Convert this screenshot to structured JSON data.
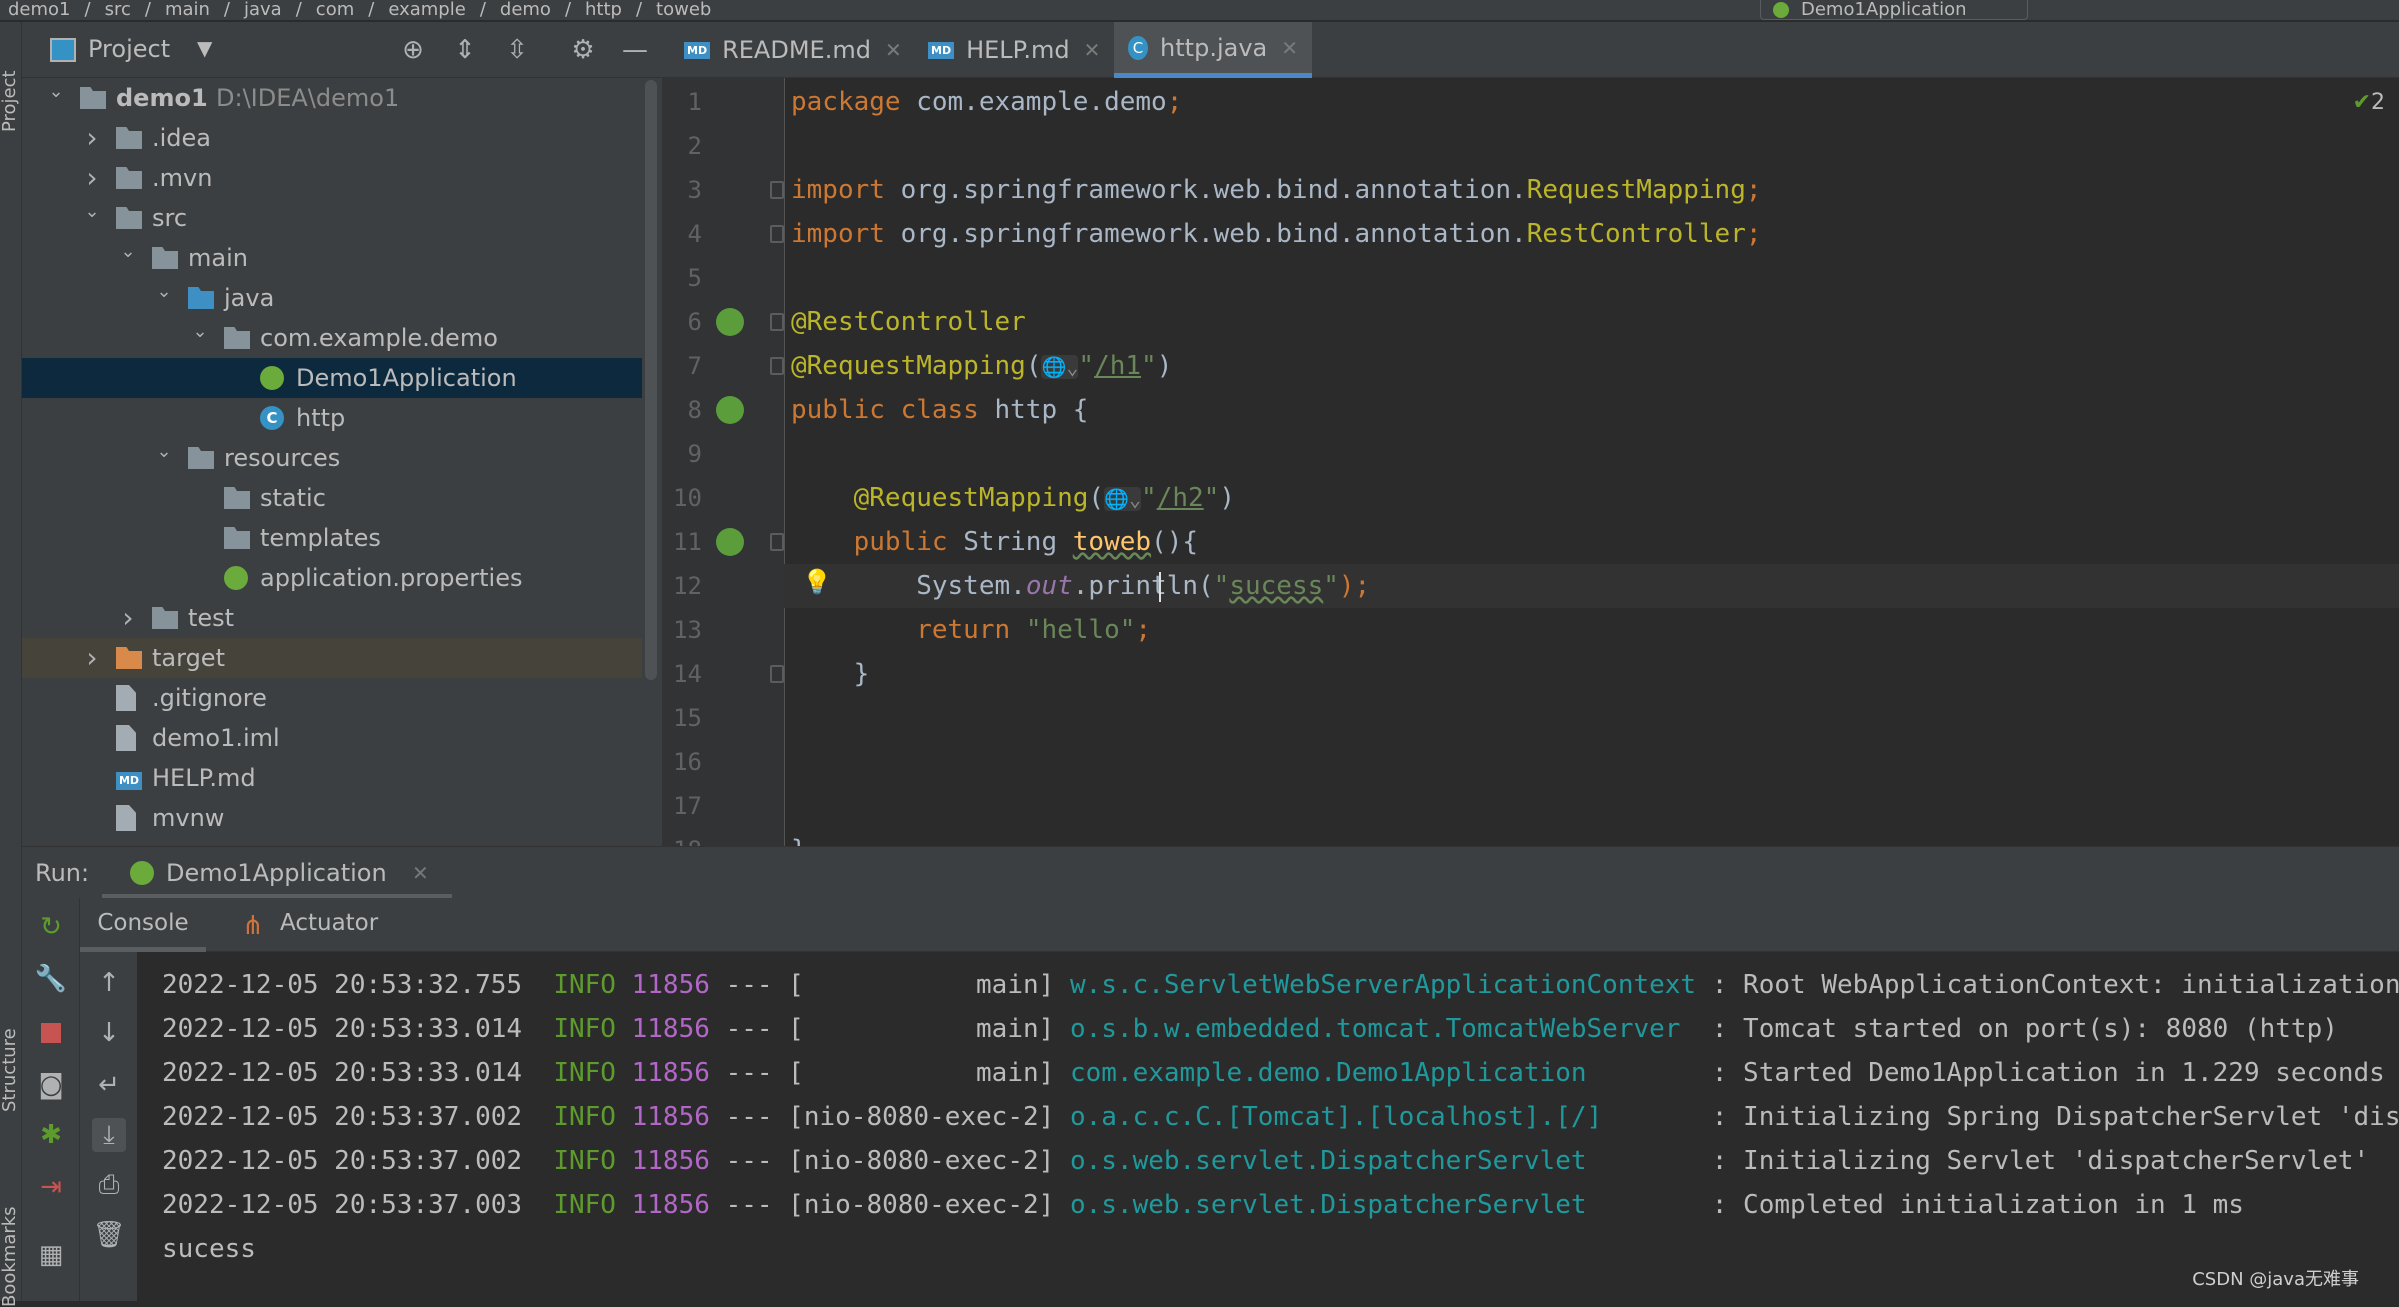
{
  "breadcrumb": [
    "demo1",
    "src",
    "main",
    "java",
    "com",
    "example",
    "demo",
    "http",
    "toweb"
  ],
  "run_config": "Demo1Application",
  "stripe": {
    "top": "Project",
    "mid": "Structure",
    "bottom": "Bookmarks"
  },
  "project_panel": {
    "title": "Project",
    "icons": [
      "locate-icon",
      "expand-all-icon",
      "collapse-all-icon",
      "gear-icon",
      "minimize-icon"
    ]
  },
  "tree": [
    {
      "label": "demo1",
      "path": "D:\\IDEA\\demo1",
      "level": 0,
      "arrow": "open",
      "icon": "folder",
      "bold": true
    },
    {
      "label": ".idea",
      "level": 1,
      "arrow": "closed",
      "icon": "folder"
    },
    {
      "label": ".mvn",
      "level": 1,
      "arrow": "closed",
      "icon": "folder"
    },
    {
      "label": "src",
      "level": 1,
      "arrow": "open",
      "icon": "folder"
    },
    {
      "label": "main",
      "level": 2,
      "arrow": "open",
      "icon": "folder"
    },
    {
      "label": "java",
      "level": 3,
      "arrow": "open",
      "icon": "folder-blue"
    },
    {
      "label": "com.example.demo",
      "level": 4,
      "arrow": "open",
      "icon": "package"
    },
    {
      "label": "Demo1Application",
      "level": 5,
      "icon": "spring-class",
      "selected": true
    },
    {
      "label": "http",
      "level": 5,
      "icon": "class"
    },
    {
      "label": "resources",
      "level": 3,
      "arrow": "open",
      "icon": "folder-resources"
    },
    {
      "label": "static",
      "level": 4,
      "icon": "folder"
    },
    {
      "label": "templates",
      "level": 4,
      "icon": "folder"
    },
    {
      "label": "application.properties",
      "level": 4,
      "icon": "spring-properties"
    },
    {
      "label": "test",
      "level": 2,
      "arrow": "closed",
      "icon": "folder"
    },
    {
      "label": "target",
      "level": 1,
      "arrow": "closed",
      "icon": "folder-orange",
      "highlight": true
    },
    {
      "label": ".gitignore",
      "level": 1,
      "icon": "file"
    },
    {
      "label": "demo1.iml",
      "level": 1,
      "icon": "file"
    },
    {
      "label": "HELP.md",
      "level": 1,
      "icon": "md"
    },
    {
      "label": "mvnw",
      "level": 1,
      "icon": "file"
    }
  ],
  "tabs": [
    {
      "label": "README.md",
      "icon": "md"
    },
    {
      "label": "HELP.md",
      "icon": "md"
    },
    {
      "label": "http.java",
      "icon": "class",
      "active": true
    }
  ],
  "editor": {
    "inspection": "2",
    "current_line": 12,
    "lines": [
      [
        [
          "package ",
          "kw"
        ],
        [
          "com.example.demo",
          "tx"
        ],
        [
          ";",
          "kw"
        ]
      ],
      [],
      [
        [
          "import ",
          "kw"
        ],
        [
          "org.springframework.web.bind.annotation.",
          "tx"
        ],
        [
          "RequestMapping",
          "cls2"
        ],
        [
          ";",
          "kw"
        ]
      ],
      [
        [
          "import ",
          "kw"
        ],
        [
          "org.springframework.web.bind.annotation.",
          "tx"
        ],
        [
          "RestController",
          "cls2"
        ],
        [
          ";",
          "kw"
        ]
      ],
      [],
      [
        [
          "@RestController",
          "an"
        ]
      ],
      [
        [
          "@RequestMapping",
          "an"
        ],
        [
          "(",
          "tx"
        ],
        [
          "🌐⌄",
          "tx"
        ],
        [
          "\"",
          "st"
        ],
        [
          "/h1",
          "st ul"
        ],
        [
          "\"",
          "st"
        ],
        [
          ")",
          "tx"
        ]
      ],
      [
        [
          "public class ",
          "kw"
        ],
        [
          "http {",
          "tx"
        ]
      ],
      [],
      [
        [
          "    @RequestMapping",
          "an"
        ],
        [
          "(",
          "tx"
        ],
        [
          "🌐⌄",
          "tx"
        ],
        [
          "\"",
          "st"
        ],
        [
          "/h2",
          "st ul"
        ],
        [
          "\"",
          "st"
        ],
        [
          ")",
          "tx"
        ]
      ],
      [
        [
          "    public ",
          "kw"
        ],
        [
          "String ",
          "tx"
        ],
        [
          "toweb",
          "me wavy"
        ],
        [
          "(){",
          "tx"
        ]
      ],
      [
        [
          "        System.",
          "tx"
        ],
        [
          "out",
          "it"
        ],
        [
          ".println(",
          "tx"
        ],
        [
          "\"",
          "st"
        ],
        [
          "sucess",
          "st wavy"
        ],
        [
          "\"",
          "st"
        ],
        [
          ");",
          "kw"
        ]
      ],
      [
        [
          "        return ",
          "kw"
        ],
        [
          "\"hello\"",
          "st"
        ],
        [
          ";",
          "kw"
        ]
      ],
      [
        [
          "    }",
          "tx"
        ]
      ],
      [],
      [],
      [],
      [
        [
          "}",
          "tx"
        ]
      ]
    ]
  },
  "run": {
    "label": "Run:",
    "tab": "Demo1Application"
  },
  "console_tabs": [
    "Console",
    "Actuator"
  ],
  "log": [
    {
      "ts": "2022-12-05 20:53:32.755",
      "level": "INFO",
      "pid": "11856",
      "sep": "---",
      "thread": "main",
      "logger": "w.s.c.ServletWebServerApplicationContext",
      "msg": "Root WebApplicationContext: initialization completed"
    },
    {
      "ts": "2022-12-05 20:53:33.014",
      "level": "INFO",
      "pid": "11856",
      "sep": "---",
      "thread": "main",
      "logger": "o.s.b.w.embedded.tomcat.TomcatWebServer",
      "msg": "Tomcat started on port(s): 8080 (http)"
    },
    {
      "ts": "2022-12-05 20:53:33.014",
      "level": "INFO",
      "pid": "11856",
      "sep": "---",
      "thread": "main",
      "logger": "com.example.demo.Demo1Application",
      "msg": "Started Demo1Application in 1.229 seconds"
    },
    {
      "ts": "2022-12-05 20:53:37.002",
      "level": "INFO",
      "pid": "11856",
      "sep": "---",
      "thread": "nio-8080-exec-2",
      "logger": "o.a.c.c.C.[Tomcat].[localhost].[/]",
      "msg": "Initializing Spring DispatcherServlet 'dispatcherServlet'"
    },
    {
      "ts": "2022-12-05 20:53:37.002",
      "level": "INFO",
      "pid": "11856",
      "sep": "---",
      "thread": "nio-8080-exec-2",
      "logger": "o.s.web.servlet.DispatcherServlet",
      "msg": "Initializing Servlet 'dispatcherServlet'"
    },
    {
      "ts": "2022-12-05 20:53:37.003",
      "level": "INFO",
      "pid": "11856",
      "sep": "---",
      "thread": "nio-8080-exec-2",
      "logger": "o.s.web.servlet.DispatcherServlet",
      "msg": "Completed initialization in 1 ms"
    }
  ],
  "output": "sucess",
  "watermark": "CSDN @java无难事",
  "colors": {
    "keyword": "#cc7832",
    "annotation": "#bbb529",
    "string": "#6a8759",
    "selection": "#0d293e",
    "accent": "#4a88c7"
  }
}
